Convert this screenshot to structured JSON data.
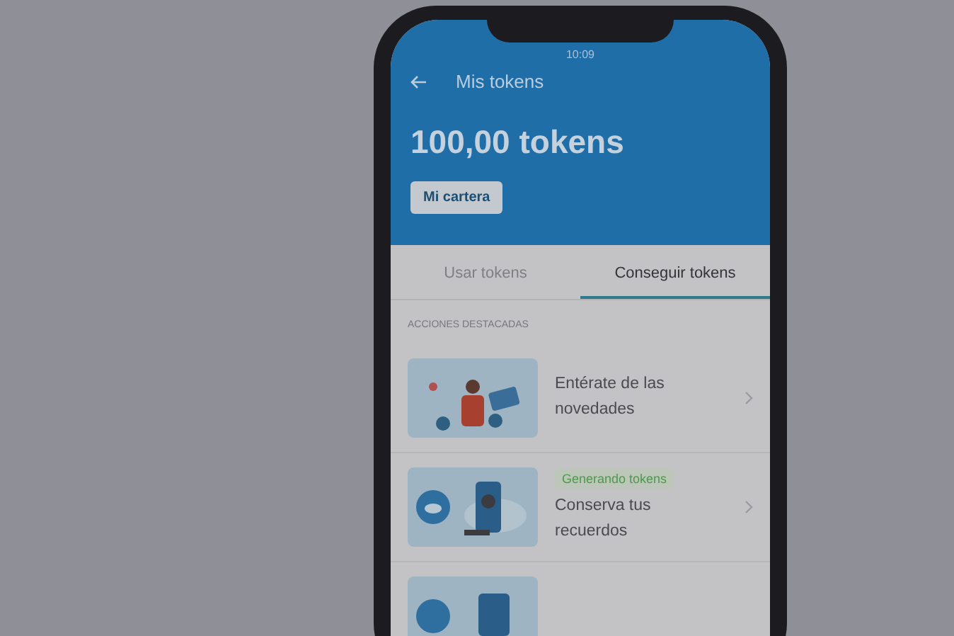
{
  "status_bar": {
    "time": "10:09"
  },
  "header": {
    "title": "Mis tokens",
    "balance": "100,00 tokens",
    "wallet_button": "Mi cartera"
  },
  "tabs": [
    {
      "label": "Usar tokens",
      "selected": false
    },
    {
      "label": "Conseguir tokens",
      "selected": true
    }
  ],
  "section_title": "ACCIONES DESTACADAS",
  "actions": [
    {
      "kind": "news",
      "title": "Entérate de las novedades"
    },
    {
      "kind": "cloud",
      "badge": "Generando tokens",
      "title": "Conserva tus recuerdos"
    },
    {
      "kind": "partial"
    }
  ]
}
